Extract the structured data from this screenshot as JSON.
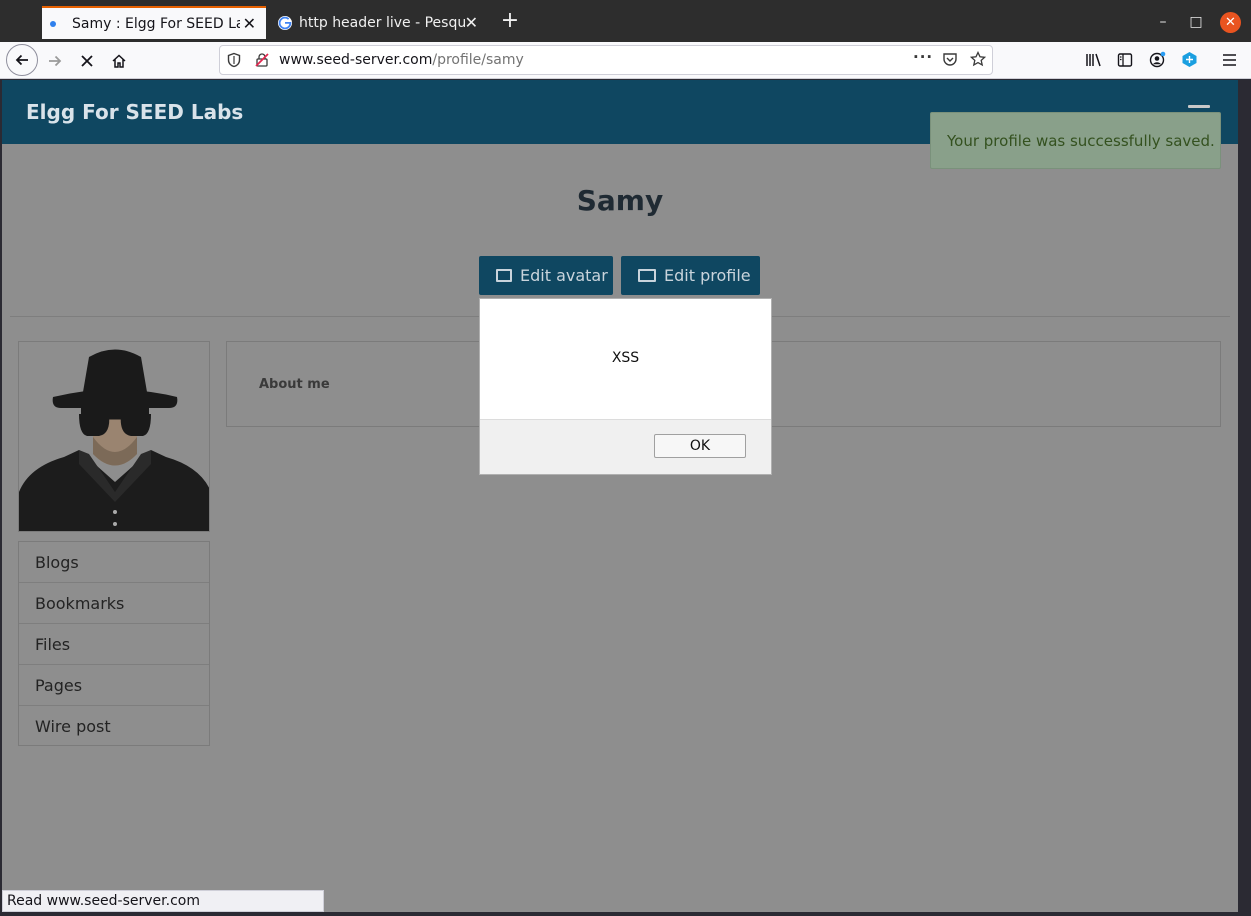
{
  "browser": {
    "tabs": [
      {
        "title": "Samy : Elgg For SEED Labs",
        "close": "✕"
      },
      {
        "title": "http header live - Pesquisa Google",
        "close": "✕"
      }
    ],
    "new_tab": "+",
    "window": {
      "minimize": "–",
      "maximize": "□",
      "close": "✕"
    },
    "url_host": "www.seed-server.com",
    "url_path": "/profile/samy",
    "status_text": "Read www.seed-server.com",
    "icons": [
      "back-icon",
      "forward-icon",
      "stop-icon",
      "home-icon",
      "shield-icon",
      "insecure-lock-icon",
      "more-icon",
      "pocket-icon",
      "star-icon",
      "library-icon",
      "sidebar-icon",
      "account-icon",
      "extension-icon",
      "menu-icon"
    ]
  },
  "site": {
    "name": "Elgg For SEED Labs",
    "flash_message": "Your profile was successfully saved.",
    "accent_color": "#0f4761"
  },
  "profile": {
    "name": "Samy",
    "edit_avatar": "Edit avatar",
    "edit_profile": "Edit profile",
    "about_label": "About me",
    "menu": [
      "Blogs",
      "Bookmarks",
      "Files",
      "Pages",
      "Wire post"
    ]
  },
  "alert": {
    "message": "XSS",
    "ok": "OK"
  }
}
